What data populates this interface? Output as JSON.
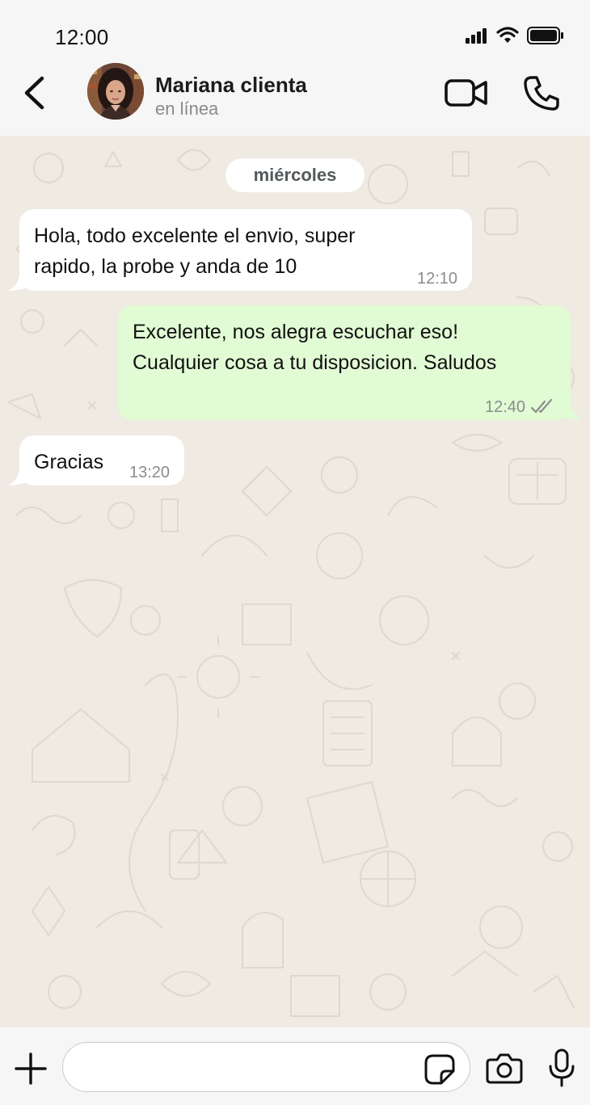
{
  "status_bar": {
    "time": "12:00"
  },
  "header": {
    "contact_name": "Mariana clienta",
    "contact_status": "en línea"
  },
  "chat": {
    "date_chip": "miércoles",
    "messages": [
      {
        "direction": "incoming",
        "text": "Hola, todo excelente el envio, super\nrapido, la probe y anda de 10",
        "time": "12:10"
      },
      {
        "direction": "outgoing",
        "text": "Excelente, nos alegra escuchar eso!\nCualquier cosa a tu disposicion. Saludos",
        "time": "12:40",
        "read_receipt": "double-check-icon"
      },
      {
        "direction": "incoming",
        "text": "Gracias",
        "time": "13:20"
      }
    ]
  },
  "composer": {
    "message_value": "",
    "message_placeholder": ""
  },
  "icons": {
    "back": "chevron-left-icon",
    "video_call": "video-camera-icon",
    "voice_call": "phone-icon",
    "attach": "plus-icon",
    "sticker": "sticker-icon",
    "camera": "camera-icon",
    "mic": "microphone-icon"
  },
  "colors": {
    "incoming_bubble": "#ffffff",
    "outgoing_bubble": "#e1fbd4",
    "chat_background": "#efeae2",
    "bar_background": "#f6f6f6",
    "timestamp": "#8c8c8c"
  }
}
